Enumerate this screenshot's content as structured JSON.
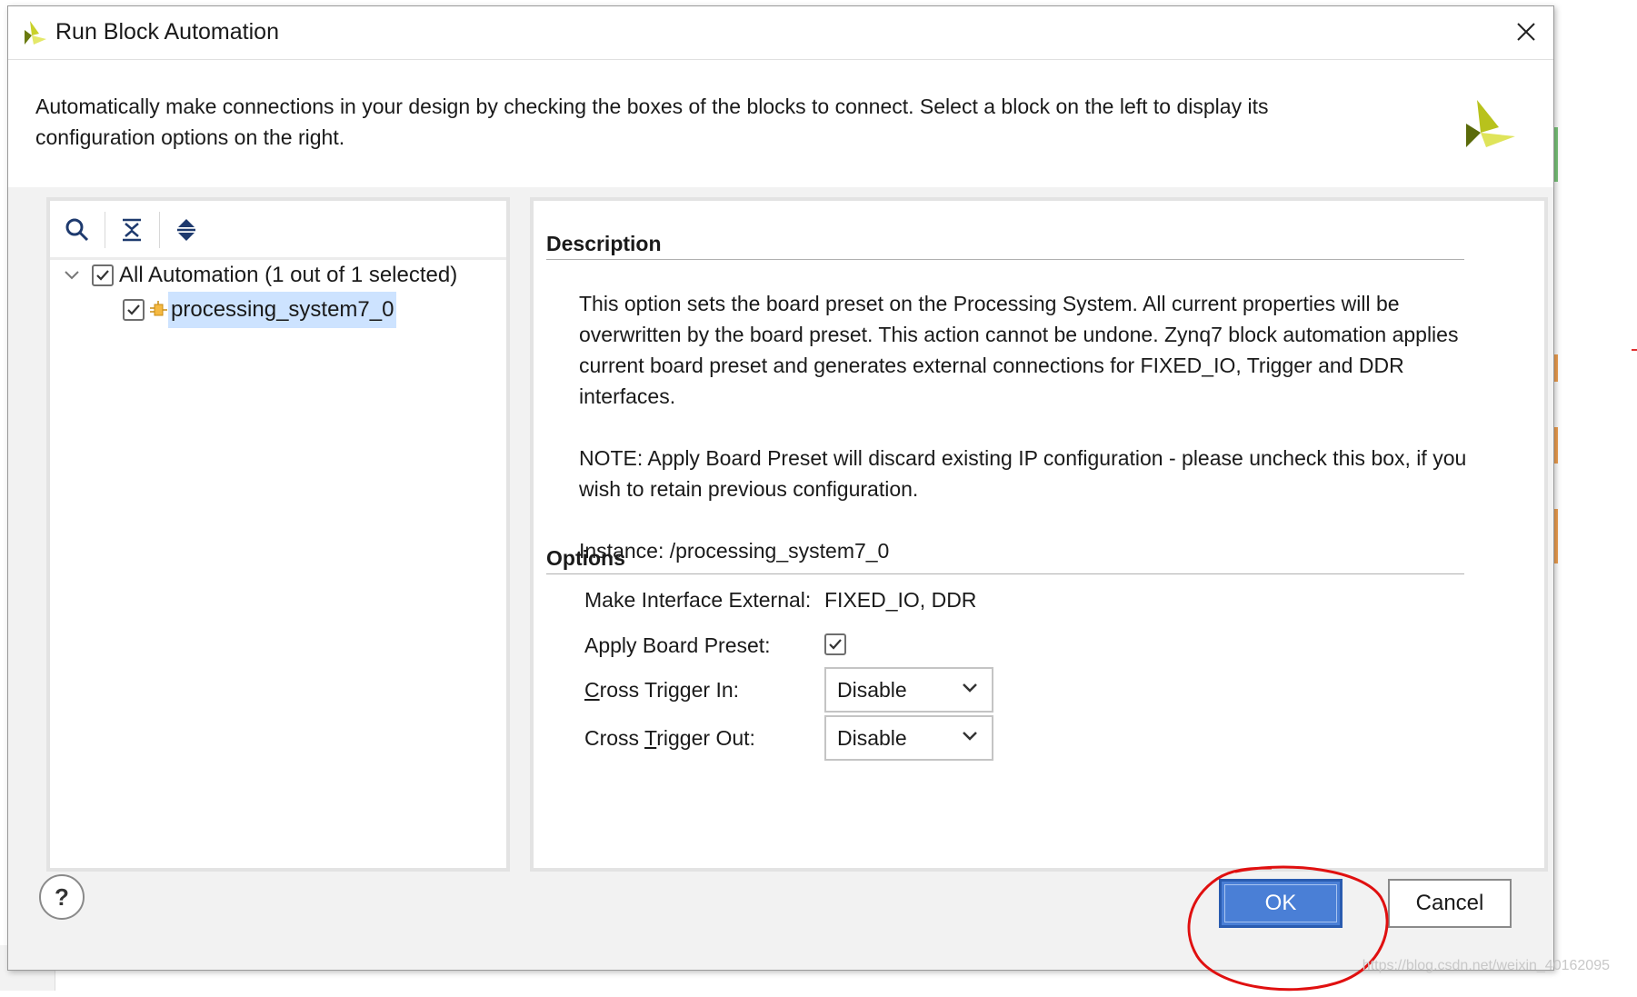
{
  "dialog": {
    "title": "Run Block Automation",
    "header_description": "Automatically make connections in your design by checking the boxes of the blocks to connect. Select a block on the left to display its configuration options on the right.",
    "icons": {
      "app_logo": "vivado-logo-icon",
      "close": "close-icon"
    }
  },
  "tree": {
    "toolbar": [
      {
        "name": "search",
        "icon": "search-icon"
      },
      {
        "name": "collapse-all",
        "icon": "collapse-all-icon"
      },
      {
        "name": "expand-all",
        "icon": "expand-all-icon"
      }
    ],
    "root": {
      "label": "All Automation (1 out of 1 selected)",
      "checked": true,
      "expanded": true
    },
    "child": {
      "label": "processing_system7_0",
      "checked": true,
      "selected": true,
      "icon": "ip-block-icon"
    }
  },
  "details": {
    "description_title": "Description",
    "description_paragraphs": [
      "This option sets the board preset on the Processing System. All current properties will be overwritten by the board preset. This action cannot be undone. Zynq7 block automation applies current board preset and generates external connections for FIXED_IO, Trigger and DDR interfaces.",
      "NOTE: Apply Board Preset will discard existing IP configuration - please uncheck this box, if you wish to retain previous configuration.",
      "Instance: /processing_system7_0"
    ],
    "options_title": "Options",
    "options": {
      "make_interface_external_label": "Make Interface External:",
      "make_interface_external_value": "FIXED_IO, DDR",
      "apply_board_preset_label": "Apply Board Preset:",
      "apply_board_preset_checked": true,
      "cross_trigger_in_label_pre": "",
      "cross_trigger_in_label_u": "C",
      "cross_trigger_in_label_post": "ross Trigger In:",
      "cross_trigger_in_value": "Disable",
      "cross_trigger_out_label_pre": "Cross ",
      "cross_trigger_out_label_u": "T",
      "cross_trigger_out_label_post": "rigger Out:",
      "cross_trigger_out_value": "Disable"
    }
  },
  "footer": {
    "help_label": "?",
    "ok_label": "OK",
    "cancel_label": "Cancel"
  },
  "background": {
    "watermark": "https://blog.csdn.net/weixin_40162095"
  },
  "colors": {
    "ok_button": "#4a7fd6",
    "selection": "#cde3ff",
    "annotation_circle": "#e01010"
  }
}
